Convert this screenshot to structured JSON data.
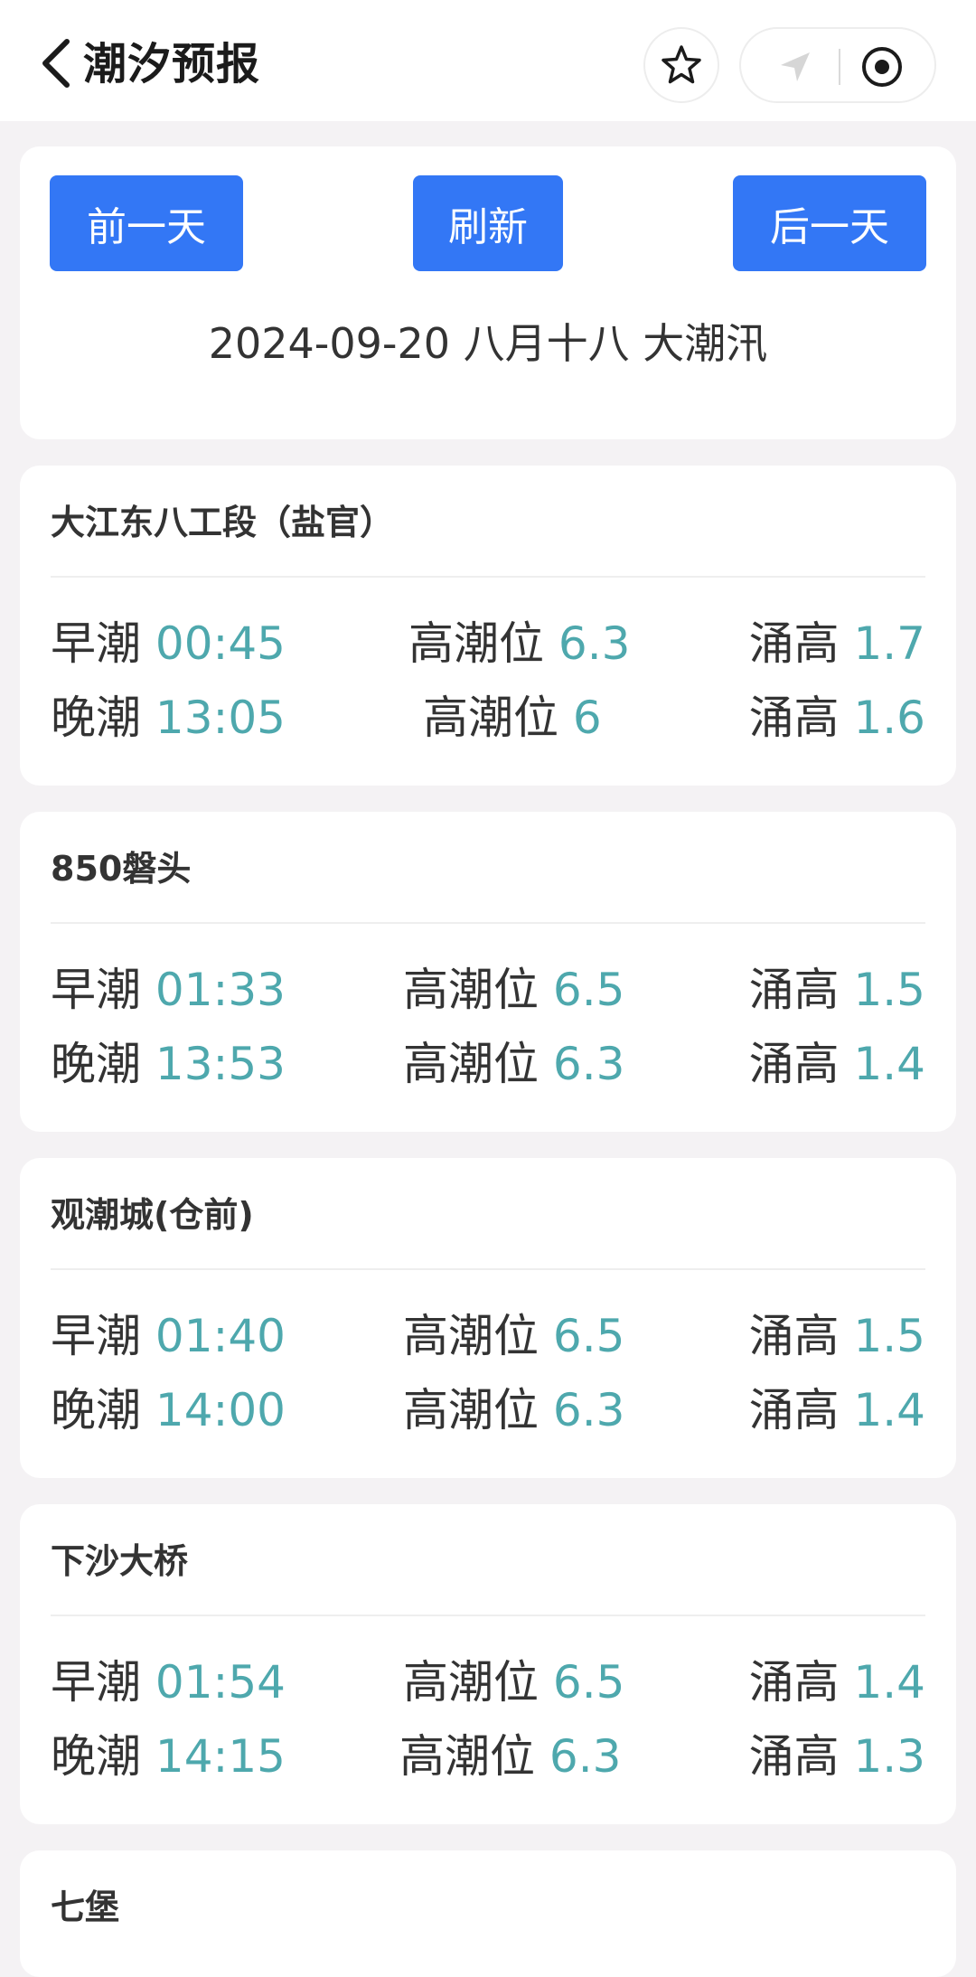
{
  "header": {
    "title": "潮汐预报"
  },
  "controls": {
    "prev_label": "前一天",
    "refresh_label": "刷新",
    "next_label": "后一天",
    "date_info": "2024-09-20 八月十八 大潮汛"
  },
  "stations": [
    {
      "name": "大江东八工段（盐官）",
      "rows": [
        {
          "tide": "早潮",
          "time": "00:45",
          "level_label": "高潮位",
          "level": "6.3",
          "surge_label": "涌高",
          "surge": "1.7"
        },
        {
          "tide": "晚潮",
          "time": "13:05",
          "level_label": "高潮位",
          "level": "6",
          "surge_label": "涌高",
          "surge": "1.6"
        }
      ]
    },
    {
      "name": "850磐头",
      "rows": [
        {
          "tide": "早潮",
          "time": "01:33",
          "level_label": "高潮位",
          "level": "6.5",
          "surge_label": "涌高",
          "surge": "1.5"
        },
        {
          "tide": "晚潮",
          "time": "13:53",
          "level_label": "高潮位",
          "level": "6.3",
          "surge_label": "涌高",
          "surge": "1.4"
        }
      ]
    },
    {
      "name": "观潮城(仓前)",
      "rows": [
        {
          "tide": "早潮",
          "time": "01:40",
          "level_label": "高潮位",
          "level": "6.5",
          "surge_label": "涌高",
          "surge": "1.5"
        },
        {
          "tide": "晚潮",
          "time": "14:00",
          "level_label": "高潮位",
          "level": "6.3",
          "surge_label": "涌高",
          "surge": "1.4"
        }
      ]
    },
    {
      "name": "下沙大桥",
      "rows": [
        {
          "tide": "早潮",
          "time": "01:54",
          "level_label": "高潮位",
          "level": "6.5",
          "surge_label": "涌高",
          "surge": "1.4"
        },
        {
          "tide": "晚潮",
          "time": "14:15",
          "level_label": "高潮位",
          "level": "6.3",
          "surge_label": "涌高",
          "surge": "1.3"
        }
      ]
    },
    {
      "name": "七堡"
    }
  ],
  "colors": {
    "accent_button": "#3377f5",
    "value_teal": "#4ea8ad"
  },
  "icons": [
    "back-arrow-icon",
    "star-icon",
    "navigation-arrow-icon",
    "record-circle-icon"
  ]
}
